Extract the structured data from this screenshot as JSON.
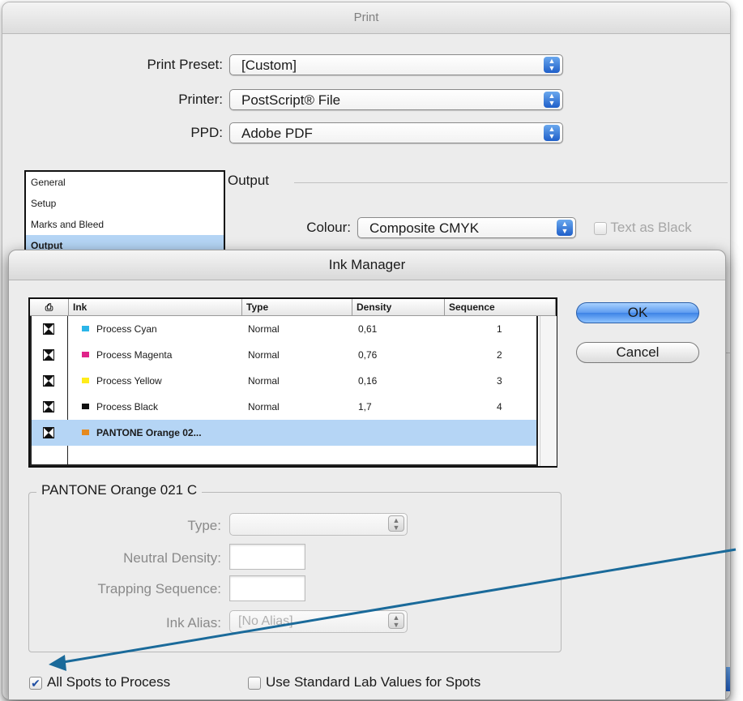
{
  "print_dialog": {
    "title": "Print",
    "print_preset_label": "Print Preset:",
    "print_preset_value": "[Custom]",
    "printer_label": "Printer:",
    "printer_value": "PostScript® File",
    "ppd_label": "PPD:",
    "ppd_value": "Adobe PDF",
    "categories": [
      "General",
      "Setup",
      "Marks and Bleed",
      "Output"
    ],
    "selected_category": "Output",
    "section_title": "Output",
    "colour_label": "Colour:",
    "colour_value": "Composite CMYK",
    "text_as_black_label": "Text as Black"
  },
  "ink_manager": {
    "title": "Ink Manager",
    "columns": [
      "Ink",
      "Type",
      "Density",
      "Sequence"
    ],
    "rows": [
      {
        "ink": "Process Cyan",
        "type": "Normal",
        "density": "0,61",
        "sequence": "1",
        "color": "#2bb5e8"
      },
      {
        "ink": "Process Magenta",
        "type": "Normal",
        "density": "0,76",
        "sequence": "2",
        "color": "#e0248a"
      },
      {
        "ink": "Process Yellow",
        "type": "Normal",
        "density": "0,16",
        "sequence": "3",
        "color": "#ffec1a"
      },
      {
        "ink": "Process Black",
        "type": "Normal",
        "density": "1,7",
        "sequence": "4",
        "color": "#111111"
      },
      {
        "ink": "PANTONE Orange 02...",
        "type": "",
        "density": "",
        "sequence": "",
        "color": "#e58a1f"
      }
    ],
    "ok_label": "OK",
    "cancel_label": "Cancel",
    "group_title": "PANTONE Orange 021 C",
    "type_label": "Type:",
    "neutral_density_label": "Neutral Density:",
    "trapping_sequence_label": "Trapping Sequence:",
    "ink_alias_label": "Ink Alias:",
    "ink_alias_value": "[No Alias]",
    "all_spots_label": "All Spots to Process",
    "all_spots_checked": true,
    "standard_lab_label": "Use Standard Lab Values for Spots",
    "standard_lab_checked": false
  },
  "colors": {
    "accent_blue": "#3d83e6",
    "callout_arrow": "#1a6a9a",
    "selection": "#b5d5f5"
  }
}
